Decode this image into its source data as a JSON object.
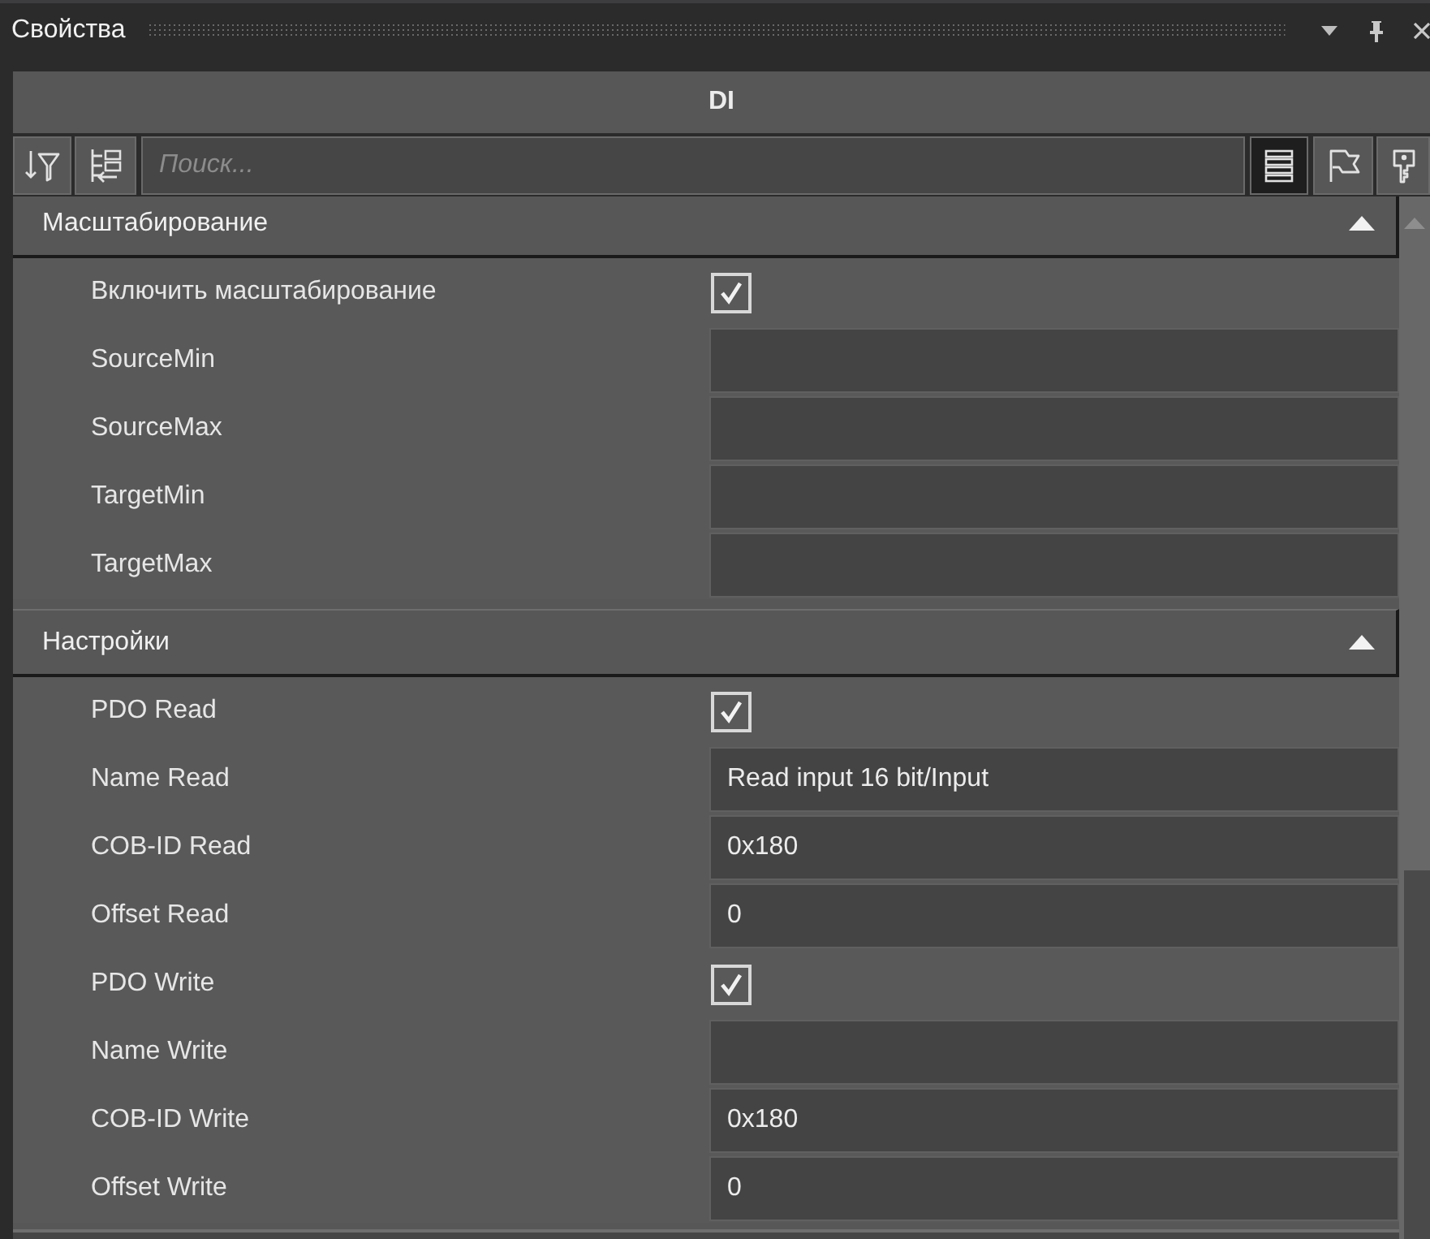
{
  "panel": {
    "title": "Свойства"
  },
  "object": {
    "name": "DI"
  },
  "toolbar": {
    "search": {
      "placeholder": "Поиск..."
    },
    "view_tabs": [
      {
        "selected": true
      },
      {
        "selected": false
      },
      {
        "selected": false
      }
    ]
  },
  "categories": [
    {
      "title": "Масштабирование",
      "expanded": true,
      "properties": [
        {
          "kind": "checkbox",
          "name": "Включить масштабирование",
          "checked": true
        },
        {
          "kind": "text",
          "name": "SourceMin"
        },
        {
          "kind": "text",
          "name": "SourceMax"
        },
        {
          "kind": "text",
          "name": "TargetMin"
        },
        {
          "kind": "text",
          "name": "TargetMax"
        }
      ]
    },
    {
      "title": "Настройки",
      "expanded": true,
      "properties": [
        {
          "kind": "checkbox",
          "name": "PDO Read",
          "checked": true
        },
        {
          "kind": "text",
          "name": "Name Read",
          "value": "Read input 16 bit/Input"
        },
        {
          "kind": "text",
          "name": "COB-ID Read",
          "value": "0x180"
        },
        {
          "kind": "text",
          "name": "Offset Read",
          "value": "0"
        },
        {
          "kind": "checkbox",
          "name": "PDO Write",
          "checked": true
        },
        {
          "kind": "text",
          "name": "Name Write"
        },
        {
          "kind": "text",
          "name": "COB-ID Write",
          "value": "0x180"
        },
        {
          "kind": "text",
          "name": "Offset Write",
          "value": "0"
        }
      ]
    }
  ]
}
